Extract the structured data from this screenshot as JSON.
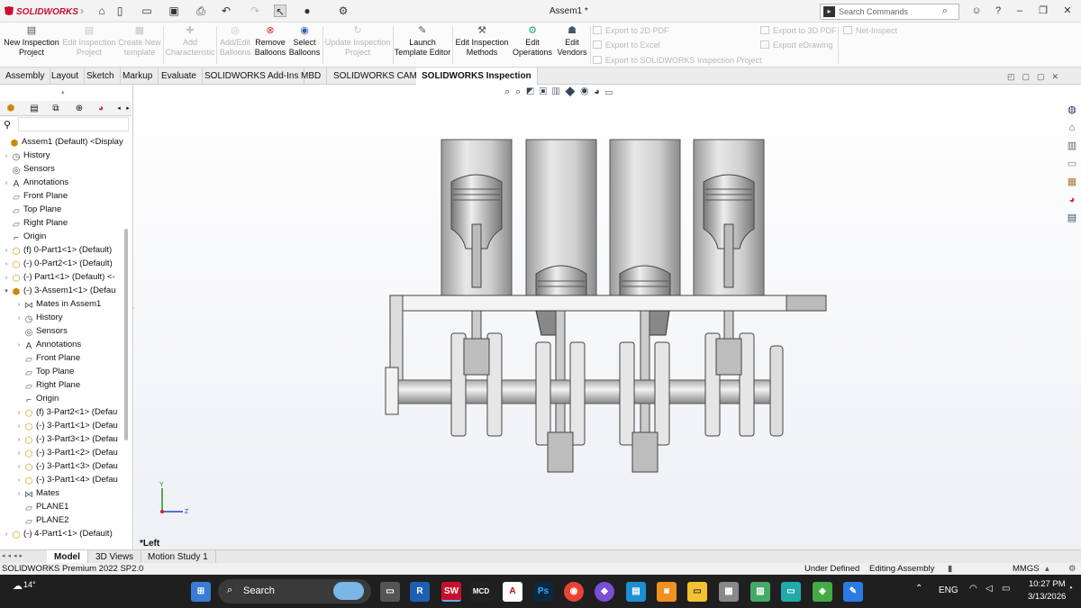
{
  "app": {
    "logo": "SOLIDWORKS",
    "title": "Assem1 *",
    "search_placeholder": "Search Commands"
  },
  "command_manager": {
    "buttons": [
      {
        "label": "New Inspection Project",
        "line1": "New Inspection",
        "line2": "Project",
        "enabled": true
      },
      {
        "label": "Edit Inspection Project",
        "line1": "Edit Inspection",
        "line2": "Project",
        "enabled": false
      },
      {
        "label": "Create New template",
        "line1": "Create New",
        "line2": "template",
        "enabled": false
      },
      {
        "label": "Add Characteristic",
        "line1": "Add",
        "line2": "Characteristic",
        "enabled": false
      },
      {
        "label": "Add/Edit Balloons",
        "line1": "Add/Edit",
        "line2": "Balloons",
        "enabled": false
      },
      {
        "label": "Remove Balloons",
        "line1": "Remove",
        "line2": "Balloons",
        "enabled": true
      },
      {
        "label": "Select Balloons",
        "line1": "Select",
        "line2": "Balloons",
        "enabled": true
      },
      {
        "label": "Update Inspection Project",
        "line1": "Update Inspection",
        "line2": "Project",
        "enabled": false
      },
      {
        "label": "Launch Template Editor",
        "line1": "Launch",
        "line2": "Template Editor",
        "enabled": true
      },
      {
        "label": "Edit Inspection Methods",
        "line1": "Edit Inspection",
        "line2": "Methods",
        "enabled": true
      },
      {
        "label": "Edit Operations",
        "line1": "Edit",
        "line2": "Operations",
        "enabled": true
      },
      {
        "label": "Edit Vendors",
        "line1": "Edit",
        "line2": "Vendors",
        "enabled": true
      }
    ],
    "exports": [
      "Export to 2D PDF",
      "Export to Excel",
      "Export to SOLIDWORKS Inspection Project",
      "Export to 3D PDF",
      "Export eDrawing",
      "Net-Inspect"
    ]
  },
  "tabs": [
    "Assembly",
    "Layout",
    "Sketch",
    "Markup",
    "Evaluate",
    "SOLIDWORKS Add-Ins",
    "MBD",
    "SOLIDWORKS CAM",
    "SOLIDWORKS Inspection"
  ],
  "active_tab": "SOLIDWORKS Inspection",
  "tree": [
    {
      "label": "Assem1 (Default) <Display S",
      "icon": "assembly-icon"
    },
    {
      "label": "History",
      "icon": "history-icon"
    },
    {
      "label": "Sensors",
      "icon": "sensor-icon"
    },
    {
      "label": "Annotations",
      "icon": "annotation-icon"
    },
    {
      "label": "Front Plane",
      "icon": "plane-icon"
    },
    {
      "label": "Top Plane",
      "icon": "plane-icon"
    },
    {
      "label": "Right Plane",
      "icon": "plane-icon"
    },
    {
      "label": "Origin",
      "icon": "origin-icon"
    },
    {
      "label": "(f) 0-Part1<1> (Default)",
      "icon": "part-icon"
    },
    {
      "label": "(-) 0-Part2<1> (Default)",
      "icon": "part-icon"
    },
    {
      "label": "(-) Part1<1> (Default) <-",
      "icon": "part-icon"
    },
    {
      "label": "(-) 3-Assem1<1> (Defau",
      "icon": "assembly-icon"
    },
    {
      "label": "Mates in Assem1",
      "icon": "mates-icon"
    },
    {
      "label": "History",
      "icon": "history-icon"
    },
    {
      "label": "Sensors",
      "icon": "sensor-icon"
    },
    {
      "label": "Annotations",
      "icon": "annotation-icon"
    },
    {
      "label": "Front Plane",
      "icon": "plane-icon"
    },
    {
      "label": "Top Plane",
      "icon": "plane-icon"
    },
    {
      "label": "Right Plane",
      "icon": "plane-icon"
    },
    {
      "label": "Origin",
      "icon": "origin-icon"
    },
    {
      "label": "(f) 3-Part2<1> (Defau",
      "icon": "part-icon"
    },
    {
      "label": "(-) 3-Part1<1> (Defau",
      "icon": "part-icon"
    },
    {
      "label": "(-) 3-Part3<1> (Defau",
      "icon": "part-icon"
    },
    {
      "label": "(-) 3-Part1<2> (Defau",
      "icon": "part-icon"
    },
    {
      "label": "(-) 3-Part1<3> (Defau",
      "icon": "part-icon"
    },
    {
      "label": "(-) 3-Part1<4> (Defau",
      "icon": "part-icon"
    },
    {
      "label": "Mates",
      "icon": "mates-icon"
    },
    {
      "label": "PLANE1",
      "icon": "plane-icon"
    },
    {
      "label": "PLANE2",
      "icon": "plane-icon"
    },
    {
      "label": "(-) 4-Part1<1> (Default)",
      "icon": "part-icon"
    }
  ],
  "viewport": {
    "view_name": "*Left",
    "axis_y": "Y",
    "axis_z": "Z"
  },
  "bottom_tabs": [
    "Model",
    "3D Views",
    "Motion Study 1"
  ],
  "status": {
    "left": "SOLIDWORKS Premium 2022 SP2.0",
    "state": "Under Defined",
    "mode": "Editing Assembly",
    "units": "MMGS"
  },
  "taskbar": {
    "weather": "14°",
    "search": "Search",
    "lang": "ENG",
    "time": "10:27 PM",
    "date": "3/13/2026"
  },
  "colors": {
    "accent": "#c8102e",
    "taskbar": "#1f1f1f",
    "viewport_top": "#ffffff"
  }
}
